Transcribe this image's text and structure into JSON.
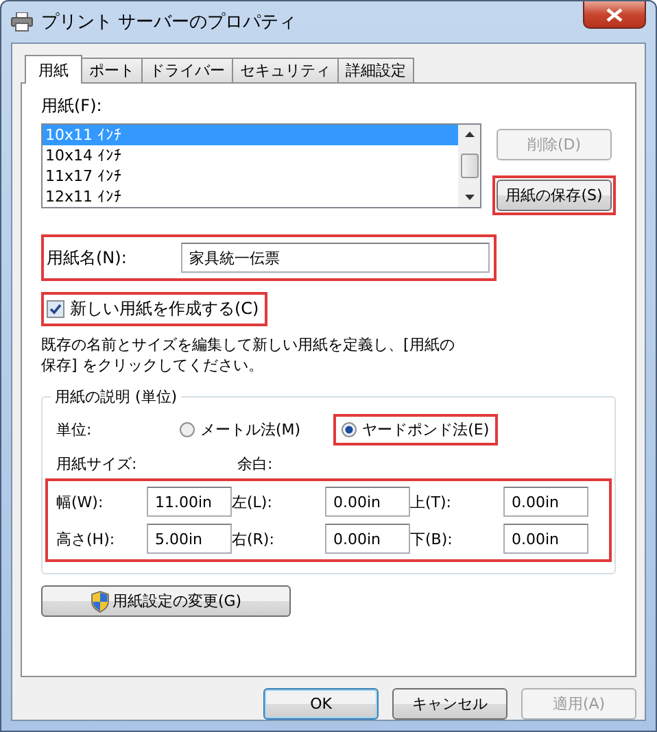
{
  "window": {
    "title": "プリント サーバーのプロパティ"
  },
  "tabs": [
    {
      "label": "用紙",
      "selected": true
    },
    {
      "label": "ポート",
      "selected": false
    },
    {
      "label": "ドライバー",
      "selected": false
    },
    {
      "label": "セキュリティ",
      "selected": false
    },
    {
      "label": "詳細設定",
      "selected": false
    }
  ],
  "paper_list": {
    "label": "用紙(F):",
    "items": [
      {
        "label": "10x11 ｲﾝﾁ",
        "selected": true
      },
      {
        "label": "10x14 ｲﾝﾁ",
        "selected": false
      },
      {
        "label": "11x17 ｲﾝﾁ",
        "selected": false
      },
      {
        "label": "12x11 ｲﾝﾁ",
        "selected": false
      }
    ]
  },
  "side_buttons": [
    {
      "label": "削除(D)",
      "disabled": true,
      "highlighted": false
    },
    {
      "label": "用紙の保存(S)",
      "disabled": false,
      "highlighted": true
    }
  ],
  "paper_name": {
    "label": "用紙名(N):",
    "value": "家具統一伝票",
    "highlighted": true
  },
  "create_new": {
    "label": "新しい用紙を作成する(C)",
    "checked": true,
    "highlighted": true
  },
  "description": "既存の名前とサイズを編集して新しい用紙を定義し、[用紙の保存] をクリックしてください。",
  "group": {
    "title": "用紙の説明 (単位)",
    "units_label": "単位:",
    "units": [
      {
        "label": "メートル法(M)",
        "selected": false,
        "highlighted": false
      },
      {
        "label": "ヤードポンド法(E)",
        "selected": true,
        "highlighted": true
      }
    ],
    "size_label": "用紙サイズ:",
    "margin_label": "余白:",
    "fields_highlighted": true,
    "fields": [
      {
        "label": "幅(W):",
        "value": "11.00in"
      },
      {
        "label": "左(L):",
        "value": "0.00in"
      },
      {
        "label": "上(T):",
        "value": "0.00in"
      },
      {
        "label": "高さ(H):",
        "value": "5.00in"
      },
      {
        "label": "右(R):",
        "value": "0.00in"
      },
      {
        "label": "下(B):",
        "value": "0.00in"
      }
    ]
  },
  "change_button": {
    "label": "用紙設定の変更(G)"
  },
  "footer_buttons": [
    {
      "label": "OK",
      "disabled": false,
      "default": true
    },
    {
      "label": "キャンセル",
      "disabled": false,
      "default": false
    },
    {
      "label": "適用(A)",
      "disabled": true,
      "default": false
    }
  ]
}
